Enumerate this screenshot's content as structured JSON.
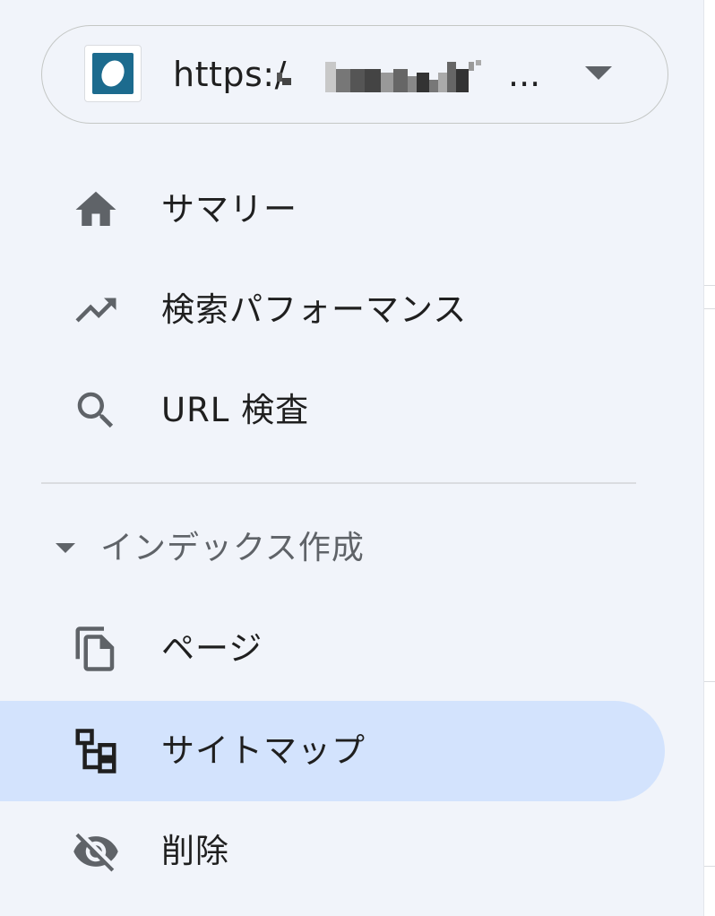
{
  "property": {
    "url_visible": "https:/",
    "ellipsis": "...",
    "favicon_color": "#1c6b8e"
  },
  "nav": {
    "items": [
      {
        "label": "サマリー",
        "icon": "home-icon"
      },
      {
        "label": "検索パフォーマンス",
        "icon": "trending-up-icon"
      },
      {
        "label": "URL 検査",
        "icon": "search-icon"
      }
    ]
  },
  "indexing": {
    "section_label": "インデックス作成",
    "items": [
      {
        "label": "ページ",
        "icon": "pages-icon"
      },
      {
        "label": "サイトマップ",
        "icon": "sitemap-icon",
        "selected": true
      },
      {
        "label": "削除",
        "icon": "visibility-off-icon"
      }
    ]
  },
  "colors": {
    "sidebar_bg": "#f1f4fa",
    "selected_bg": "#d3e3fd",
    "icon_gray": "#5f6368",
    "text": "#1f1f1f"
  }
}
